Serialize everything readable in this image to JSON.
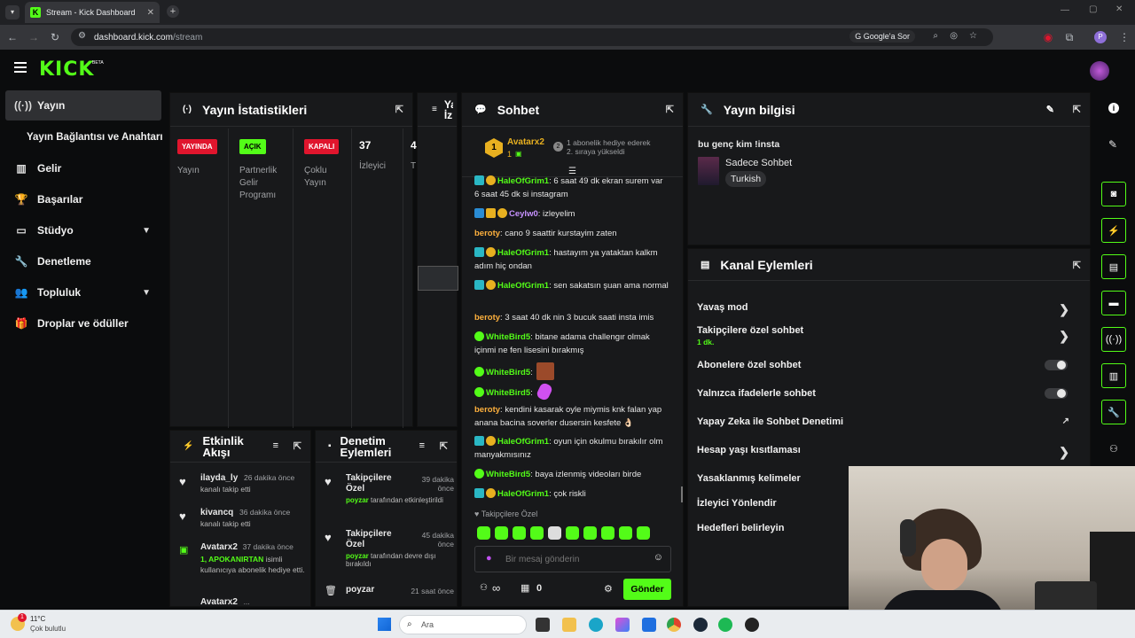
{
  "browser": {
    "tab_title": "Stream - Kick Dashboard",
    "url_domain": "dashboard.kick.com",
    "url_path": "/stream",
    "ask_google": "Google'a Sor",
    "profile_initial": "P"
  },
  "header": {
    "logo": "KICK",
    "beta": "BETA"
  },
  "sidebar": {
    "items": [
      {
        "label": "Yayın",
        "icon": "broadcast-icon"
      },
      {
        "label": "Yayın Bağlantısı ve Anahtarı"
      },
      {
        "label": "Gelir",
        "icon": "chart-icon"
      },
      {
        "label": "Başarılar",
        "icon": "trophy-icon"
      },
      {
        "label": "Stüdyo",
        "icon": "studio-icon"
      },
      {
        "label": "Denetleme",
        "icon": "wrench-icon"
      },
      {
        "label": "Topluluk",
        "icon": "people-icon"
      },
      {
        "label": "Droplar ve ödüller",
        "icon": "gift-icon"
      }
    ]
  },
  "stats": {
    "title": "Yayın İstatistikleri",
    "cols": [
      {
        "badge": "YAYINDA",
        "label": "Yayın",
        "badge_color": "#e0152d"
      },
      {
        "badge": "AÇIK",
        "label": "Partnerlik Gelir Programı",
        "badge_color": "#53fc18"
      },
      {
        "badge": "KAPALI",
        "label": "Çoklu Yayın",
        "badge_color": "#e0152d"
      },
      {
        "value": "37",
        "label": "İzleyici"
      },
      {
        "value": "4",
        "label": "T"
      }
    ]
  },
  "preview": {
    "title": "Ya İz"
  },
  "activity": {
    "title": "Etkinlik Akışı",
    "items": [
      {
        "user": "ilayda_ly",
        "time": "26 dakika önce",
        "text": "kanalı takip etti"
      },
      {
        "user": "kivancq",
        "time": "36 dakika önce",
        "text": "kanalı takip etti"
      },
      {
        "user": "Avatarx2",
        "time": "37 dakika önce",
        "highlight": "1, APOKANIRTAN",
        "text": "isimli kullanıcıya abonelik hediye etti."
      },
      {
        "user": "Avatarx2",
        "time": "..."
      }
    ]
  },
  "moderation": {
    "title": "Denetim Eylemleri",
    "items": [
      {
        "title": "Takipçilere Özel",
        "time": "39 dakika önce",
        "user": "poyzar",
        "text": "tarafından etkinleştirildi"
      },
      {
        "title": "Takipçilere Özel",
        "time": "45 dakika önce",
        "user": "poyzar",
        "text": "tarafından devre dışı bırakıldı"
      },
      {
        "title": "poyzar",
        "time": "21 saat önce"
      }
    ]
  },
  "chat": {
    "title": "Sohbet",
    "pinned_user": "Avatarx2",
    "pinned_count": "1",
    "gift_text_1": "1 abonelik hediye ederek",
    "gift_text_2": "2. sıraya yükseldi",
    "messages": [
      {
        "user": "HaleOfGrim1",
        "color": "#53fc18",
        "text": "6 saat 49 dk ekran surem var 6 saat 45 dk si instagram"
      },
      {
        "user": "Ceylw0",
        "color": "#c792ff",
        "text": "izleyelim"
      },
      {
        "user": "beroty",
        "color": "#ffb13d",
        "text": "cano 9 saattir kurstayim zaten"
      },
      {
        "user": "HaleOfGrim1",
        "color": "#53fc18",
        "text": "hastayım ya yataktan kalkm adım hiç ondan"
      },
      {
        "user": "HaleOfGrim1",
        "color": "#53fc18",
        "text": "sen sakatsın şuan ama normal"
      },
      {
        "user": "beroty",
        "color": "#ffb13d",
        "text": "3 saat 40 dk nin 3 bucuk saati insta imis"
      },
      {
        "user": "WhiteBird5",
        "color": "#53fc18",
        "text": "bitane adama challengır olmak içinmi ne fen lisesini bırakmış"
      },
      {
        "user": "WhiteBird5",
        "color": "#53fc18",
        "text": ""
      },
      {
        "user": "WhiteBird5",
        "color": "#53fc18",
        "text": ""
      },
      {
        "user": "beroty",
        "color": "#ffb13d",
        "text": "kendini kasarak oyle miymis knk falan yap anana bacina soverler dusersin kesfete 👌🏻"
      },
      {
        "user": "HaleOfGrim1",
        "color": "#53fc18",
        "text": "oyun için okulmu bırakılır olm manyakmısınız"
      },
      {
        "user": "WhiteBird5",
        "color": "#53fc18",
        "text": "baya izlenmiş videoları birde"
      },
      {
        "user": "HaleOfGrim1",
        "color": "#53fc18",
        "text": "çok riskli"
      }
    ],
    "mode_label": "Takipçilere Özel",
    "placeholder": "Bir mesaj gönderin",
    "count_left": "∞",
    "count_right": "0",
    "send": "Gönder"
  },
  "info": {
    "title": "Yayın bilgisi",
    "stream_title": "bu genç kim !insta",
    "category": "Sadece Sohbet",
    "tag": "Turkish"
  },
  "channel": {
    "title": "Kanal Eylemleri",
    "rows": [
      {
        "label": "Yavaş mod",
        "type": "arrow"
      },
      {
        "label": "Takipçilere özel sohbet",
        "sub": "1 dk.",
        "type": "arrow"
      },
      {
        "label": "Abonelere özel sohbet",
        "type": "toggle"
      },
      {
        "label": "Yalnızca ifadelerle sohbet",
        "type": "toggle"
      },
      {
        "label": "Yapay Zeka ile Sohbet Denetimi",
        "type": "link"
      },
      {
        "label": "Hesap yaşı kısıtlaması",
        "type": "arrow"
      },
      {
        "label": "Yasaklanmış kelimeler",
        "type": "none"
      },
      {
        "label": "İzleyici Yönlendir",
        "type": "none"
      },
      {
        "label": "Hedefleri belirleyin",
        "type": "none"
      }
    ]
  },
  "taskbar": {
    "temp": "11°C",
    "weather": "Çok bulutlu",
    "notif": "1",
    "search": "Ara"
  }
}
